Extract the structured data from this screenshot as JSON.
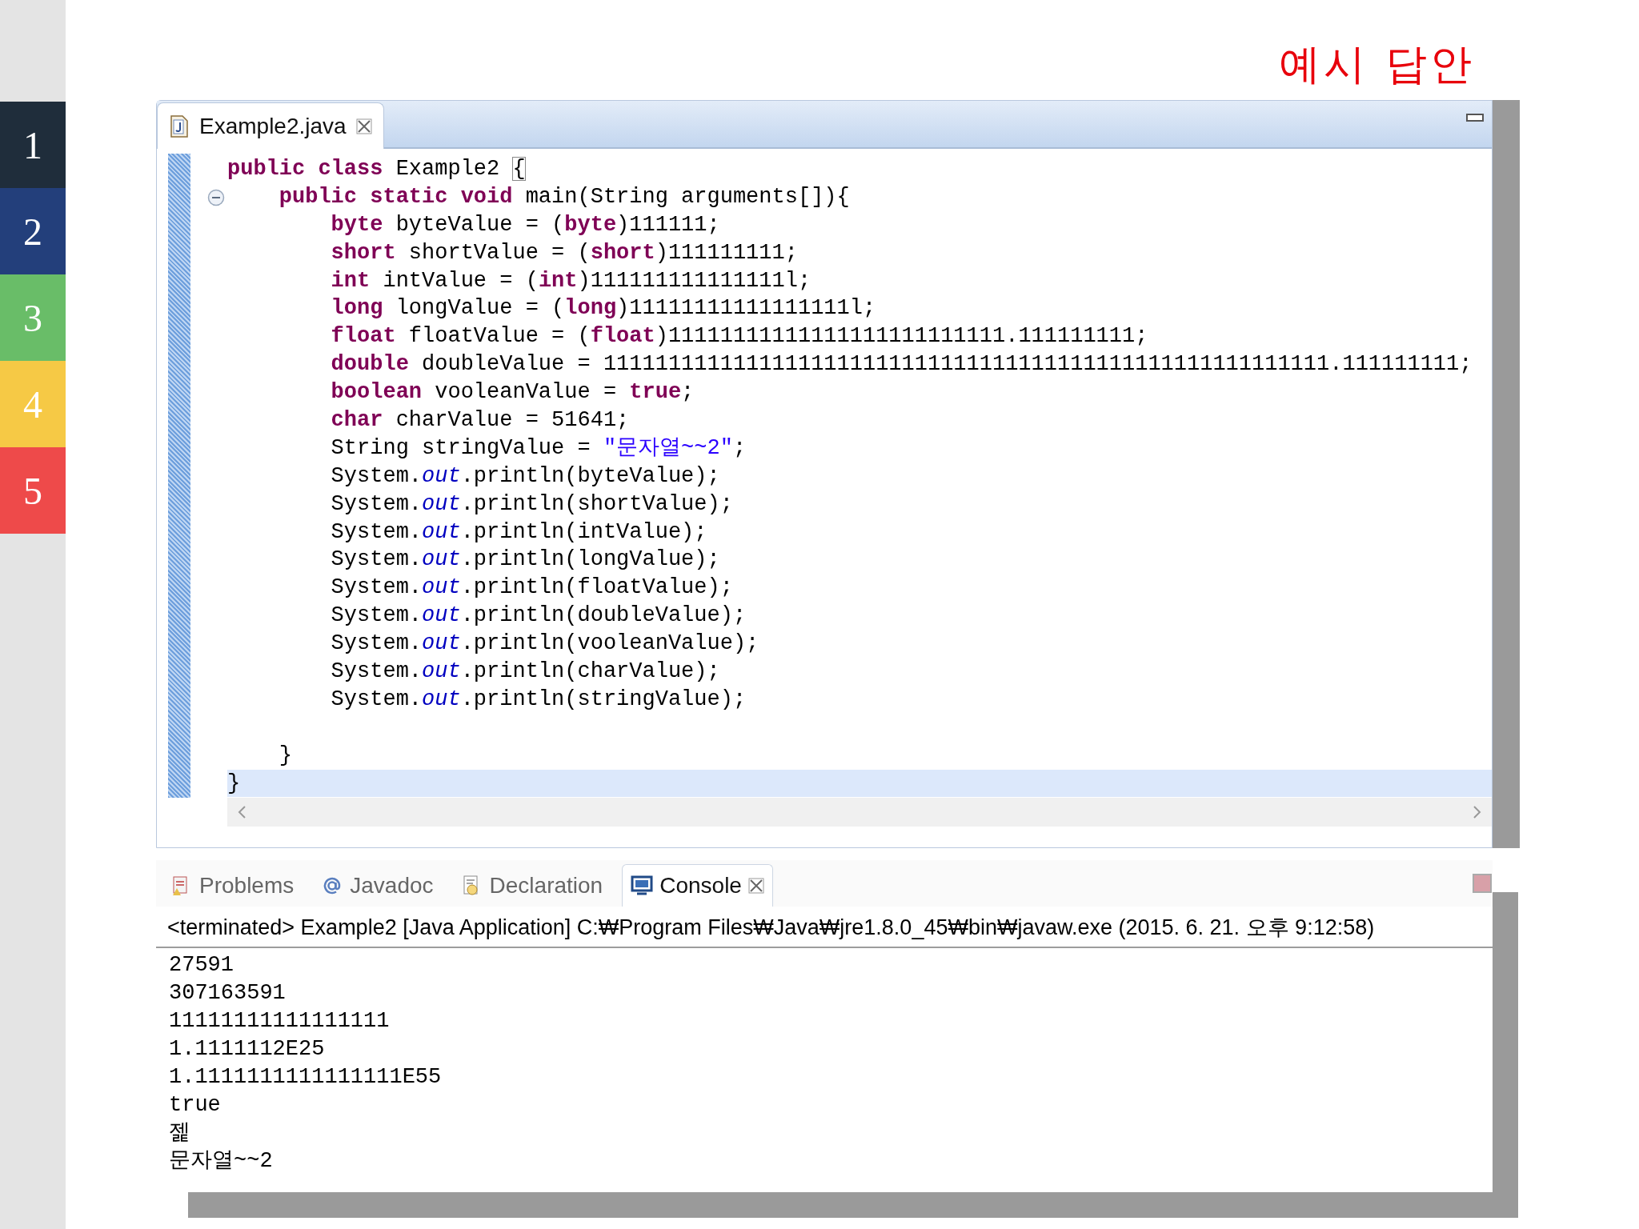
{
  "sidebar": {
    "items": [
      {
        "label": "1",
        "color": "#1f2d3b"
      },
      {
        "label": "2",
        "color": "#233f7b"
      },
      {
        "label": "3",
        "color": "#69bd68"
      },
      {
        "label": "4",
        "color": "#f6c945"
      },
      {
        "label": "5",
        "color": "#ee4a4a"
      }
    ]
  },
  "title": "예시 답안",
  "editor": {
    "tab": {
      "label": "Example2.java",
      "selected": true
    },
    "lines": [
      {
        "current": false,
        "segments": [
          {
            "kind": "keyword",
            "text": "public"
          },
          {
            "kind": "keyword",
            "text": " class"
          },
          {
            "kind": "plain",
            "text": " Example2 "
          },
          {
            "kind": "match",
            "text": "{"
          }
        ]
      },
      {
        "current": false,
        "segments": [
          {
            "kind": "keyword",
            "text": "    public"
          },
          {
            "kind": "keyword",
            "text": " static"
          },
          {
            "kind": "keyword",
            "text": " void"
          },
          {
            "kind": "plain",
            "text": " main(String arguments[]){"
          }
        ]
      },
      {
        "current": false,
        "segments": [
          {
            "kind": "keyword",
            "text": "        byte"
          },
          {
            "kind": "plain",
            "text": " byteValue = ("
          },
          {
            "kind": "keyword",
            "text": "byte"
          },
          {
            "kind": "plain",
            "text": ")111111;"
          }
        ]
      },
      {
        "current": false,
        "segments": [
          {
            "kind": "keyword",
            "text": "        short"
          },
          {
            "kind": "plain",
            "text": " shortValue = ("
          },
          {
            "kind": "keyword",
            "text": "short"
          },
          {
            "kind": "plain",
            "text": ")111111111;"
          }
        ]
      },
      {
        "current": false,
        "segments": [
          {
            "kind": "keyword",
            "text": "        int"
          },
          {
            "kind": "plain",
            "text": " intValue = ("
          },
          {
            "kind": "keyword",
            "text": "int"
          },
          {
            "kind": "plain",
            "text": ")111111111111111l;"
          }
        ]
      },
      {
        "current": false,
        "segments": [
          {
            "kind": "keyword",
            "text": "        long"
          },
          {
            "kind": "plain",
            "text": " longValue = ("
          },
          {
            "kind": "keyword",
            "text": "long"
          },
          {
            "kind": "plain",
            "text": ")11111111111111111l;"
          }
        ]
      },
      {
        "current": false,
        "segments": [
          {
            "kind": "keyword",
            "text": "        float"
          },
          {
            "kind": "plain",
            "text": " floatValue = ("
          },
          {
            "kind": "keyword",
            "text": "float"
          },
          {
            "kind": "plain",
            "text": ")11111111111111111111111111.111111111;"
          }
        ]
      },
      {
        "current": false,
        "segments": [
          {
            "kind": "keyword",
            "text": "        double"
          },
          {
            "kind": "plain",
            "text": " doubleValue = 11111111111111111111111111111111111111111111111111111111.111111111;"
          }
        ]
      },
      {
        "current": false,
        "segments": [
          {
            "kind": "keyword",
            "text": "        boolean"
          },
          {
            "kind": "plain",
            "text": " vooleanValue = "
          },
          {
            "kind": "keyword",
            "text": "true"
          },
          {
            "kind": "plain",
            "text": ";"
          }
        ]
      },
      {
        "current": false,
        "segments": [
          {
            "kind": "keyword",
            "text": "        char"
          },
          {
            "kind": "plain",
            "text": " charValue = 51641;"
          }
        ]
      },
      {
        "current": false,
        "segments": [
          {
            "kind": "plain",
            "text": "        String stringValue = "
          },
          {
            "kind": "string",
            "text": "\"문자열~~2\""
          },
          {
            "kind": "plain",
            "text": ";"
          }
        ]
      },
      {
        "current": false,
        "segments": [
          {
            "kind": "plain",
            "text": "        System."
          },
          {
            "kind": "field",
            "text": "out"
          },
          {
            "kind": "plain",
            "text": ".println(byteValue);"
          }
        ]
      },
      {
        "current": false,
        "segments": [
          {
            "kind": "plain",
            "text": "        System."
          },
          {
            "kind": "field",
            "text": "out"
          },
          {
            "kind": "plain",
            "text": ".println(shortValue);"
          }
        ]
      },
      {
        "current": false,
        "segments": [
          {
            "kind": "plain",
            "text": "        System."
          },
          {
            "kind": "field",
            "text": "out"
          },
          {
            "kind": "plain",
            "text": ".println(intValue);"
          }
        ]
      },
      {
        "current": false,
        "segments": [
          {
            "kind": "plain",
            "text": "        System."
          },
          {
            "kind": "field",
            "text": "out"
          },
          {
            "kind": "plain",
            "text": ".println(longValue);"
          }
        ]
      },
      {
        "current": false,
        "segments": [
          {
            "kind": "plain",
            "text": "        System."
          },
          {
            "kind": "field",
            "text": "out"
          },
          {
            "kind": "plain",
            "text": ".println(floatValue);"
          }
        ]
      },
      {
        "current": false,
        "segments": [
          {
            "kind": "plain",
            "text": "        System."
          },
          {
            "kind": "field",
            "text": "out"
          },
          {
            "kind": "plain",
            "text": ".println(doubleValue);"
          }
        ]
      },
      {
        "current": false,
        "segments": [
          {
            "kind": "plain",
            "text": "        System."
          },
          {
            "kind": "field",
            "text": "out"
          },
          {
            "kind": "plain",
            "text": ".println(vooleanValue);"
          }
        ]
      },
      {
        "current": false,
        "segments": [
          {
            "kind": "plain",
            "text": "        System."
          },
          {
            "kind": "field",
            "text": "out"
          },
          {
            "kind": "plain",
            "text": ".println(charValue);"
          }
        ]
      },
      {
        "current": false,
        "segments": [
          {
            "kind": "plain",
            "text": "        System."
          },
          {
            "kind": "field",
            "text": "out"
          },
          {
            "kind": "plain",
            "text": ".println(stringValue);"
          }
        ]
      },
      {
        "current": false
      },
      {
        "current": false,
        "segments": [
          {
            "kind": "plain",
            "text": "    }"
          }
        ]
      },
      {
        "current": true,
        "segments": [
          {
            "kind": "plain",
            "text": "}"
          }
        ]
      }
    ]
  },
  "console": {
    "tabs": [
      {
        "label": "Problems",
        "kind": "problems",
        "selected": false
      },
      {
        "label": "Javadoc",
        "kind": "javadoc",
        "selected": false
      },
      {
        "label": "Declaration",
        "kind": "declaration",
        "selected": false
      },
      {
        "label": "Console",
        "kind": "console",
        "selected": true
      }
    ],
    "header": "<terminated> Example2 [Java Application] C:₩Program Files₩Java₩jre1.8.0_45₩bin₩javaw.exe (2015. 6. 21. 오후 9:12:58)",
    "output": [
      "27591",
      "307163591",
      "11111111111111111",
      "1.1111112E25",
      "1.1111111111111111E55",
      "true",
      "젩",
      "문자열~~2"
    ]
  }
}
